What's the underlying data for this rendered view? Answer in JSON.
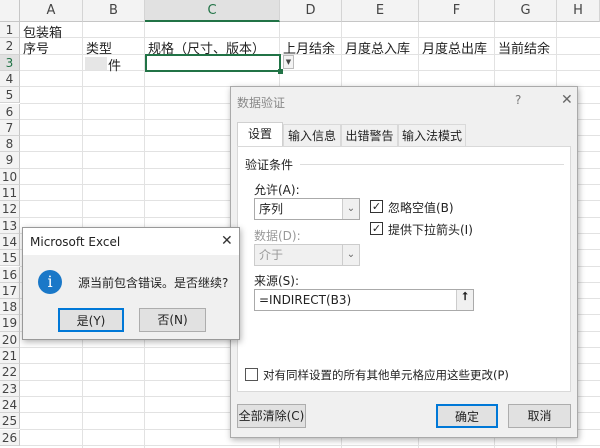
{
  "sheet": {
    "columns": [
      "A",
      "B",
      "C",
      "D",
      "E",
      "F",
      "G",
      "H"
    ],
    "rows": [
      "1",
      "2",
      "3",
      "4",
      "5",
      "6",
      "7",
      "8",
      "9",
      "10",
      "11",
      "12",
      "13",
      "14",
      "15",
      "16",
      "17",
      "18",
      "19",
      "20",
      "21",
      "22",
      "23",
      "24",
      "25",
      "26"
    ],
    "A1": "包装箱",
    "headers": [
      "序号",
      "类型",
      "规格（尺寸、版本）",
      "上月结余",
      "月度总入库",
      "月度总出库",
      "当前结余"
    ],
    "B3": "件"
  },
  "dialog": {
    "title": "数据验证",
    "help": "?",
    "close": "✕",
    "tabs": [
      "设置",
      "输入信息",
      "出错警告",
      "输入法模式"
    ],
    "section": "验证条件",
    "allow_label": "允许(A):",
    "allow_value": "序列",
    "data_label": "数据(D):",
    "data_value": "介于",
    "ignore_blank": "忽略空值(B)",
    "dropdown": "提供下拉箭头(I)",
    "source_label": "来源(S):",
    "source_value": "=INDIRECT(B3)",
    "apply_all": "对有同样设置的所有其他单元格应用这些更改(P)",
    "clear_all": "全部清除(C)",
    "ok": "确定",
    "cancel": "取消"
  },
  "msgbox": {
    "title": "Microsoft Excel",
    "close": "✕",
    "message": "源当前包含错误。是否继续?",
    "yes": "是(Y)",
    "no": "否(N)"
  }
}
